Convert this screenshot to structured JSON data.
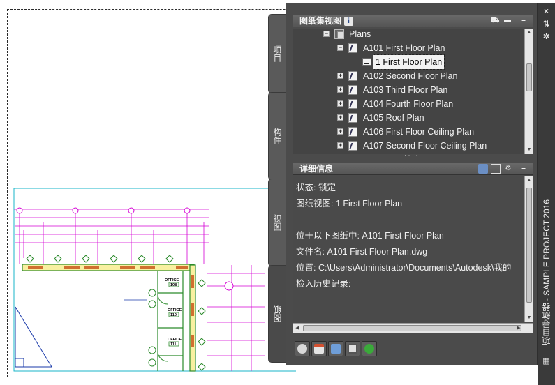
{
  "side_tabs": [
    "项目",
    "构件",
    "视图",
    "图纸"
  ],
  "active_tab": "图纸",
  "palette_title": "项目导航器 - SAMPLE PROJECT 2016",
  "sheet_set_panel": {
    "title": "图纸集视图",
    "info_glyph": "i",
    "icons": [
      "publish-icon",
      "folder-icon",
      "minimize-icon"
    ],
    "minimize_glyph": "–",
    "tree": [
      {
        "level": 0,
        "expander": "−",
        "icon": "plans-folder-icon",
        "label": "Plans"
      },
      {
        "level": 1,
        "expander": "−",
        "icon": "sheet-locked-icon",
        "label": "A101 First Floor Plan"
      },
      {
        "level": 2,
        "expander": "",
        "icon": "view-icon",
        "label": "1 First Floor Plan",
        "selected": true
      },
      {
        "level": 1,
        "expander": "+",
        "icon": "sheet-icon",
        "label": "A102 Second Floor Plan"
      },
      {
        "level": 1,
        "expander": "+",
        "icon": "sheet-icon",
        "label": "A103 Third Floor Plan"
      },
      {
        "level": 1,
        "expander": "+",
        "icon": "sheet-icon",
        "label": "A104 Fourth Floor Plan"
      },
      {
        "level": 1,
        "expander": "+",
        "icon": "sheet-icon",
        "label": "A105 Roof Plan"
      },
      {
        "level": 1,
        "expander": "+",
        "icon": "sheet-icon",
        "label": "A106 First Floor Ceiling Plan"
      },
      {
        "level": 1,
        "expander": "+",
        "icon": "sheet-icon",
        "label": "A107 Second Floor Ceiling Plan"
      }
    ]
  },
  "details_panel": {
    "title": "详细信息",
    "minimize_glyph": "–",
    "lines": [
      "状态: 锁定",
      "图纸视图: 1 First Floor Plan",
      "",
      "位于以下图纸中: A101 First Floor Plan",
      "文件名: A101 First Floor Plan.dwg",
      "位置: C:\\Users\\Administrator\\Documents\\Autodesk\\我的",
      "检入历史记录:"
    ]
  },
  "titlebar_buttons": [
    "×",
    "⇅",
    "✲"
  ],
  "drawing": {
    "office_label": "OFFICE",
    "room_numbers": [
      "108",
      "110",
      "111"
    ]
  },
  "colors": {
    "panel_bg": "#4b4b4b",
    "dark_bg": "#3a3a3a",
    "magenta": "#d500d5",
    "cyan": "#19b6c8",
    "green": "#2a8a2a"
  }
}
